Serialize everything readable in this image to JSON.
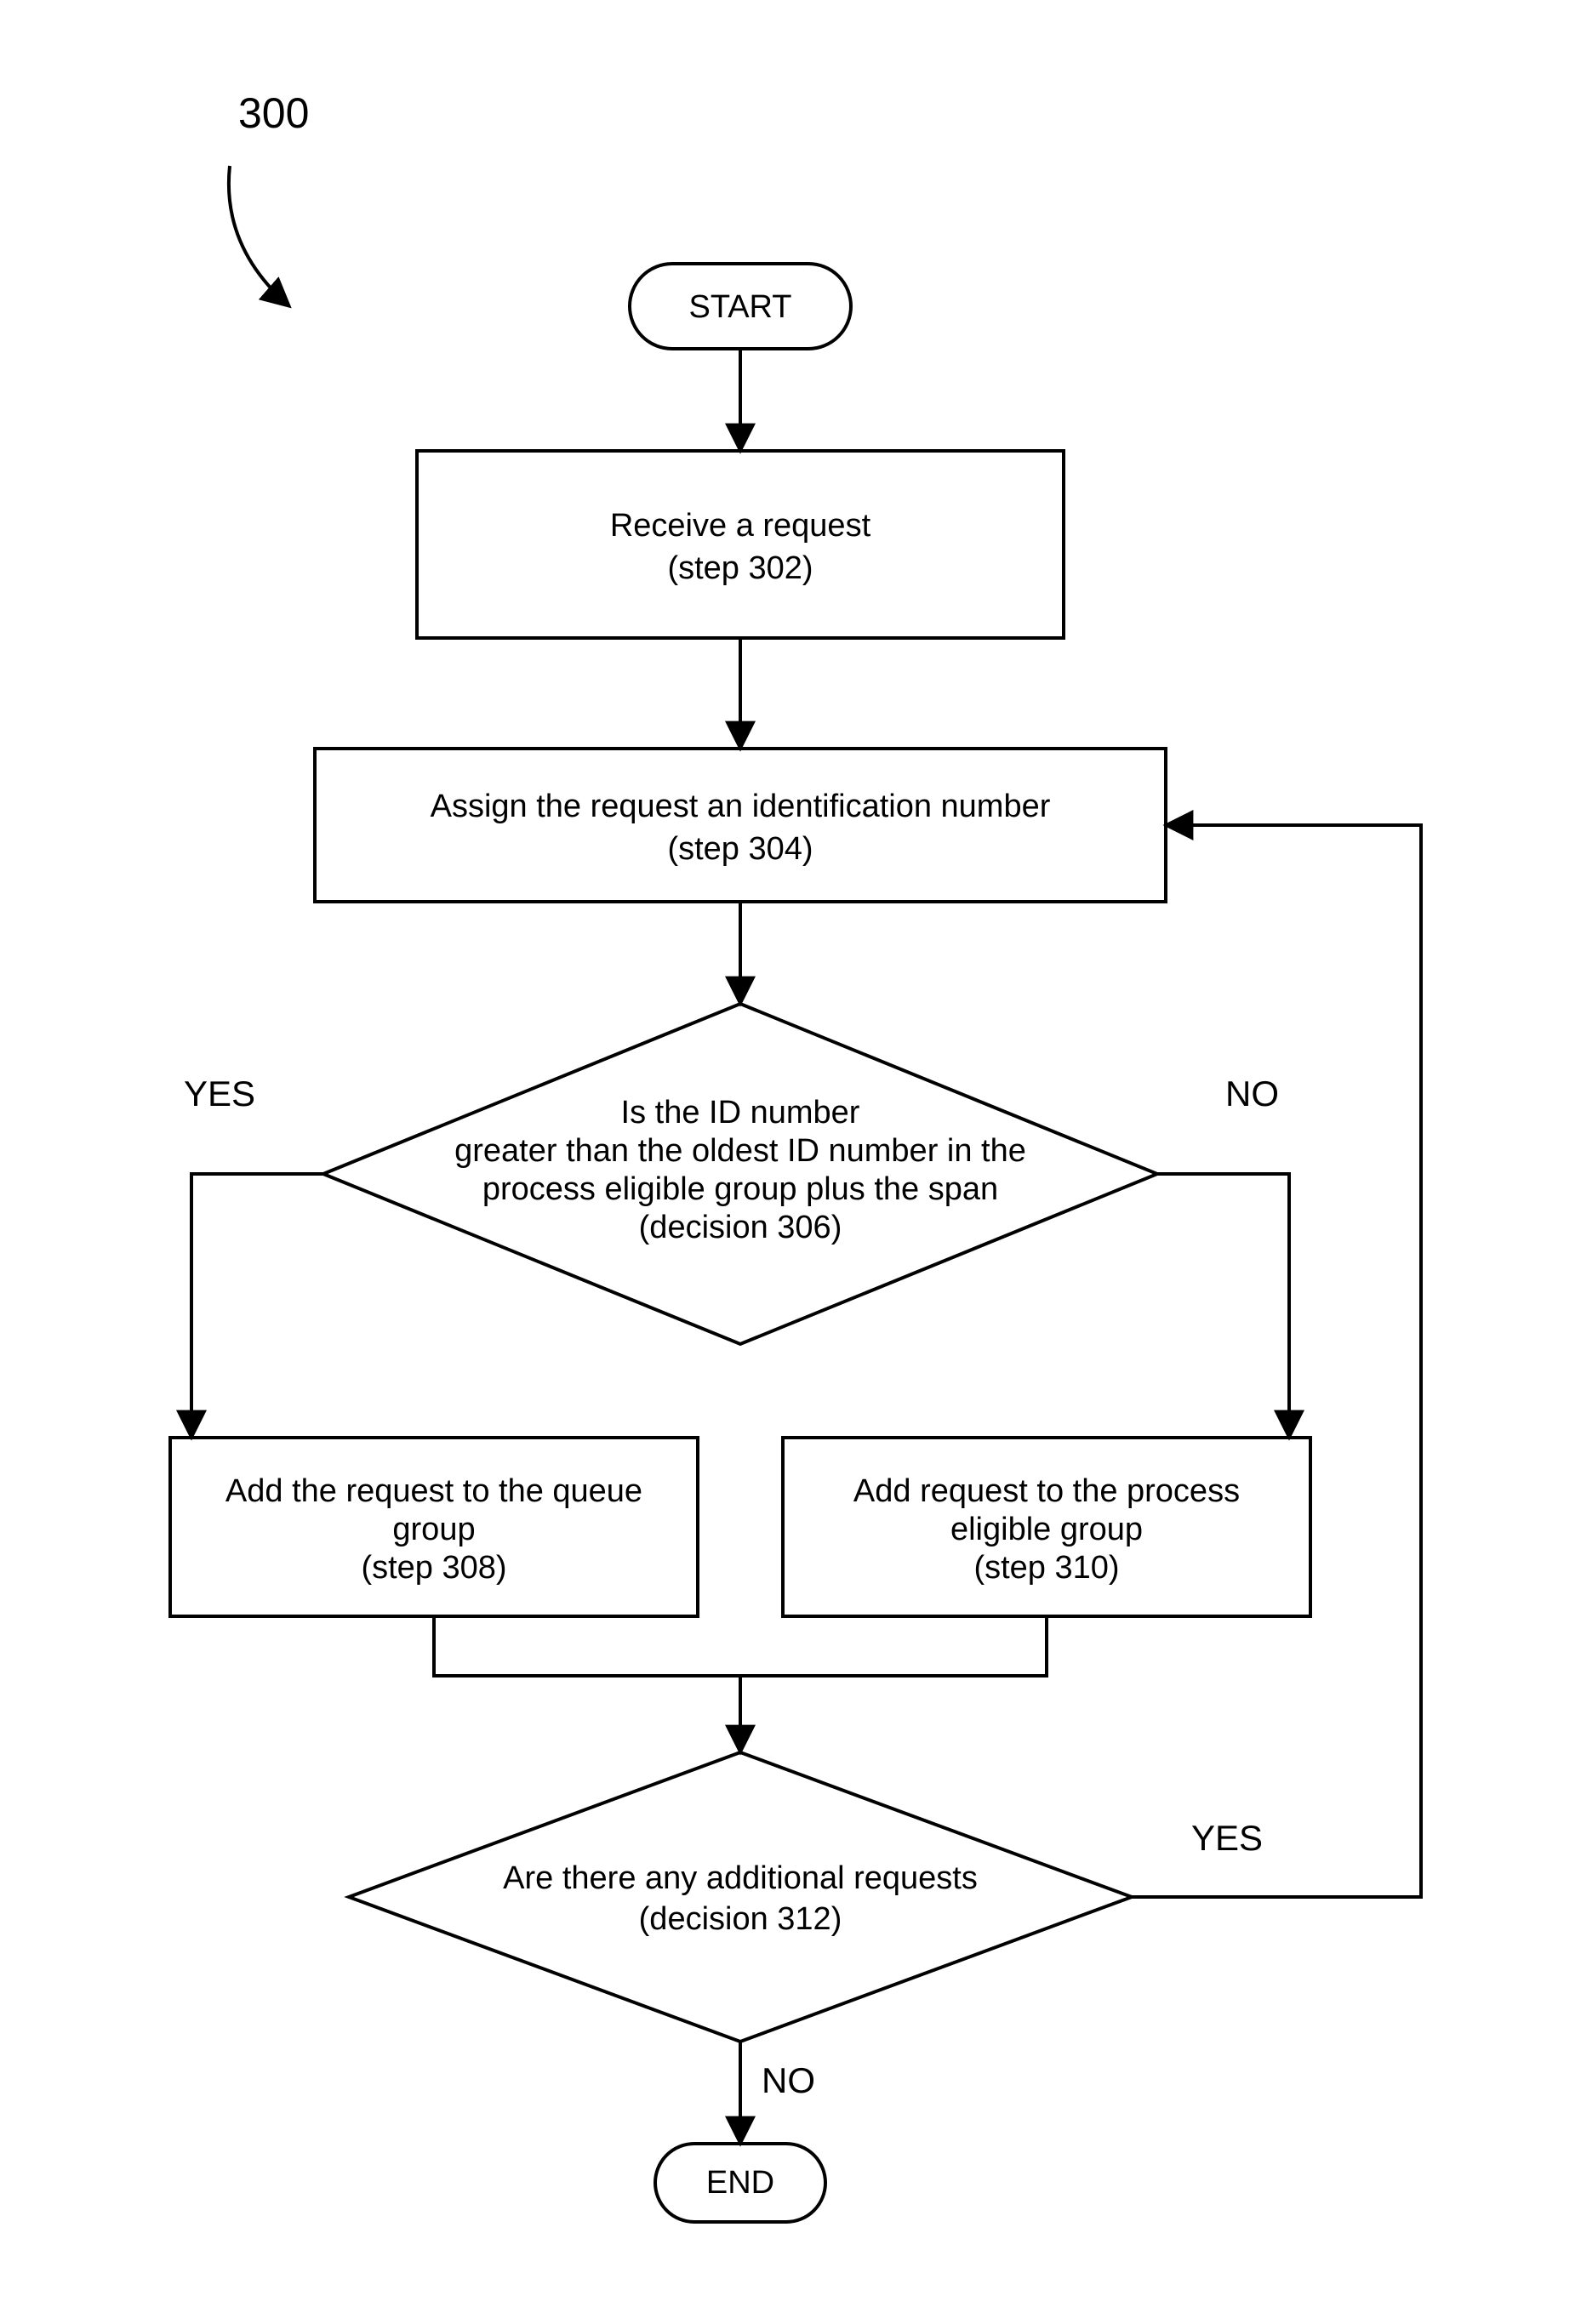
{
  "figure_ref": "300",
  "nodes": {
    "start": "START",
    "step302": {
      "line1": "Receive a request",
      "line2": "(step 302)"
    },
    "step304": {
      "line1": "Assign the request an identification number",
      "line2": "(step 304)"
    },
    "decision306": {
      "line1": "Is the ID number",
      "line2": "greater than the oldest ID number in the",
      "line3": "process eligible group plus the span",
      "line4": "(decision 306)"
    },
    "step308": {
      "line1": "Add the request to the queue",
      "line2": "group",
      "line3": "(step 308)"
    },
    "step310": {
      "line1": "Add request to the process",
      "line2": "eligible group",
      "line3": "(step 310)"
    },
    "decision312": {
      "line1": "Are there any additional requests",
      "line2": "(decision 312)"
    },
    "end": "END"
  },
  "labels": {
    "yes": "YES",
    "no": "NO"
  }
}
